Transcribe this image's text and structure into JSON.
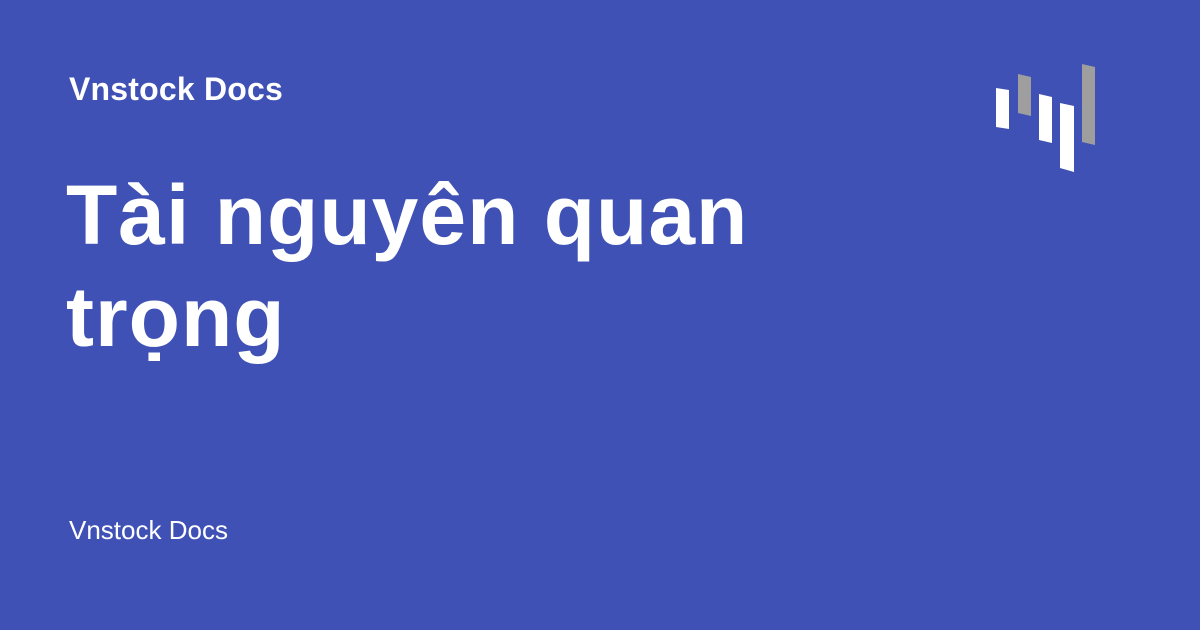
{
  "header": {
    "site_name": "Vnstock Docs"
  },
  "main": {
    "title": "Tài nguyên quan trọng"
  },
  "footer": {
    "site_name": "Vnstock Docs"
  },
  "colors": {
    "background": "#3f51b5",
    "text": "#ffffff",
    "logo_light": "#ffffff",
    "logo_gray": "#9e9e9e"
  },
  "logo": {
    "icon": "vnstock-bars-logo-icon"
  }
}
